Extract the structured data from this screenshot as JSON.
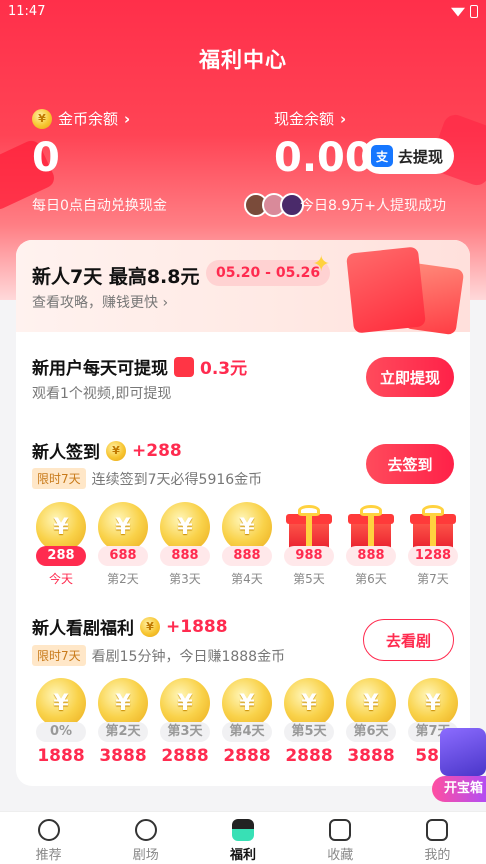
{
  "status": {
    "time": "11:47"
  },
  "page": {
    "title": "福利中心"
  },
  "balances": {
    "coin_label": "金币余额",
    "coin_value": "0",
    "coin_note": "每日0点自动兑换现金",
    "cash_label": "现金余额",
    "cash_value": "0.00",
    "withdraw_button": "去提现",
    "withdraw_note": "今日8.9万+人提现成功"
  },
  "banner": {
    "title": "新人7天 最高8.8元",
    "date_range": "05.20 - 05.26",
    "subtitle": "查看攻略，赚钱更快"
  },
  "new_user": {
    "title": "新用户每天可提现",
    "amount": "0.3元",
    "subtitle": "观看1个视频,即可提现",
    "button": "立即提现"
  },
  "checkin": {
    "title": "新人签到",
    "bonus": "+288",
    "tag": "限时7天",
    "subtitle": "连续签到7天必得5916金币",
    "button": "去签到",
    "days": [
      {
        "reward": "288",
        "label": "今天",
        "type": "coin"
      },
      {
        "reward": "688",
        "label": "第2天",
        "type": "coin"
      },
      {
        "reward": "888",
        "label": "第3天",
        "type": "coin"
      },
      {
        "reward": "888",
        "label": "第4天",
        "type": "coin"
      },
      {
        "reward": "988",
        "label": "第5天",
        "type": "gift"
      },
      {
        "reward": "888",
        "label": "第6天",
        "type": "gift"
      },
      {
        "reward": "1288",
        "label": "第7天",
        "type": "gift"
      }
    ]
  },
  "drama": {
    "title": "新人看剧福利",
    "bonus": "+1888",
    "tag": "限时7天",
    "subtitle": "看剧15分钟，今日赚1888金币",
    "button": "去看剧",
    "days": [
      {
        "progress": "0%",
        "amount": "1888"
      },
      {
        "progress": "第2天",
        "amount": "3888"
      },
      {
        "progress": "第3天",
        "amount": "2888"
      },
      {
        "progress": "第4天",
        "amount": "2888"
      },
      {
        "progress": "第5天",
        "amount": "2888"
      },
      {
        "progress": "第6天",
        "amount": "3888"
      },
      {
        "progress": "第7天",
        "amount": "588"
      }
    ]
  },
  "treasure": {
    "label": "开宝箱"
  },
  "nav": [
    {
      "label": "推荐"
    },
    {
      "label": "剧场"
    },
    {
      "label": "福利"
    },
    {
      "label": "收藏"
    },
    {
      "label": "我的"
    }
  ],
  "colors": {
    "brand": "#ff2b4f",
    "header": "#ff4455",
    "coin": "#f7c531"
  }
}
